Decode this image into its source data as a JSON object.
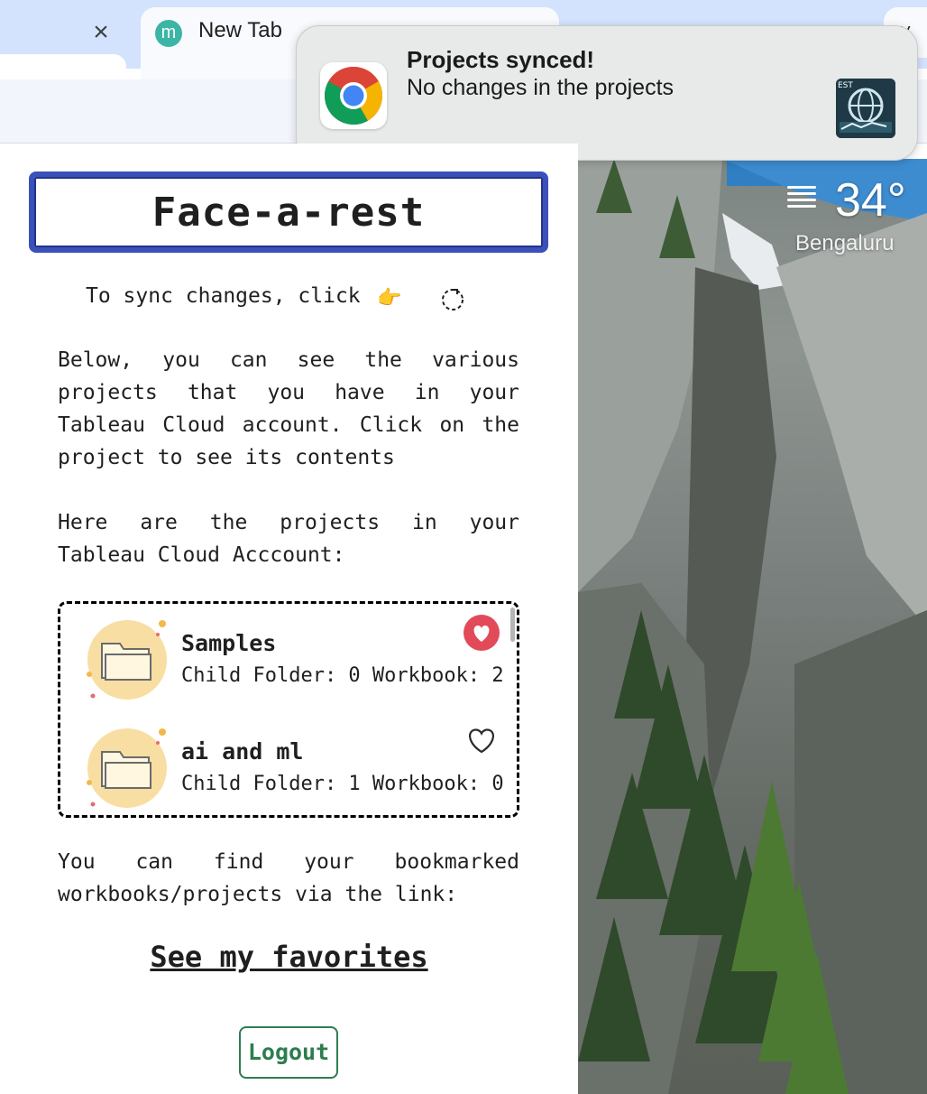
{
  "browser": {
    "close_glyph": "×",
    "tab": {
      "favicon_letter": "m",
      "title": "New Tab"
    },
    "menu_glyph": "˅"
  },
  "notification": {
    "title": "Projects synced!",
    "body": "No changes in the projects",
    "thumb_text": "EST"
  },
  "weather": {
    "temperature": "34°",
    "city": "Bengaluru"
  },
  "extension": {
    "title": "Face-a-rest",
    "sync_text": "To sync changes, click",
    "pointer_glyph": "👉",
    "intro": "Below, you can see the various projects that you have in your Tableau Cloud account. Click on the project to see its contents",
    "projects_heading": "Here are the projects in your Tableau Cloud Acccount:",
    "projects": [
      {
        "name": "Samples",
        "meta": "Child Folder: 0 Workbook: 2",
        "favorited": true
      },
      {
        "name": "ai and ml",
        "meta": "Child Folder: 1 Workbook: 0",
        "favorited": false
      }
    ],
    "bookmark_text": "You can find your bookmarked workbooks/projects via the link:",
    "favorites_link": "See my favorites",
    "logout_label": "Logout"
  },
  "colors": {
    "title_border": "#3b50b8",
    "favorite_active": "#e24a59",
    "logout": "#2e7d4f",
    "folder_circle": "#f8dea2"
  }
}
